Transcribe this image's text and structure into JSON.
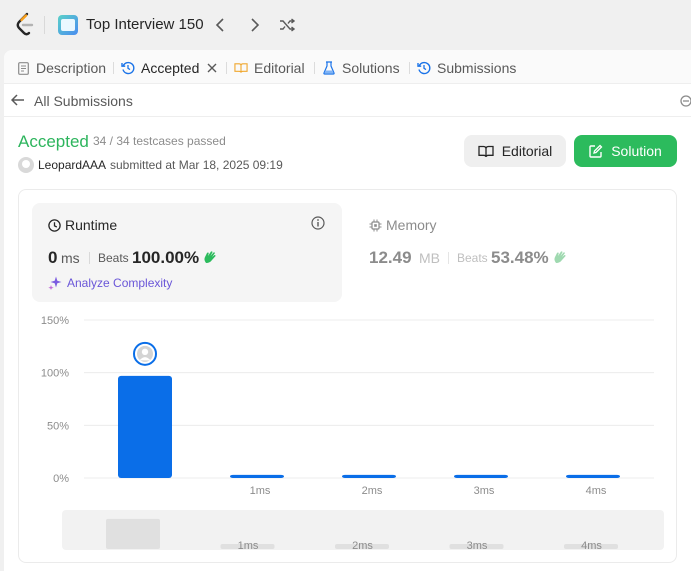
{
  "topbar": {
    "list_title": "Top Interview 150"
  },
  "tabs": [
    {
      "label": "Description",
      "icon": "description-icon"
    },
    {
      "label": "Accepted",
      "icon": "history-icon"
    },
    {
      "label": "Editorial",
      "icon": "book-icon"
    },
    {
      "label": "Solutions",
      "icon": "flask-icon"
    },
    {
      "label": "Submissions",
      "icon": "history-icon"
    }
  ],
  "subbar": {
    "back_label": "All Submissions"
  },
  "result": {
    "status": "Accepted",
    "testcases": "34 / 34 testcases passed",
    "username": "LeopardAAA",
    "submitted": "submitted at Mar 18, 2025 09:19"
  },
  "buttons": {
    "editorial": "Editorial",
    "solution": "Solution"
  },
  "runtime": {
    "title": "Runtime",
    "value": "0",
    "unit": "ms",
    "beats_label": "Beats",
    "beats_pct": "100.00%",
    "analyze": "Analyze Complexity"
  },
  "memory": {
    "title": "Memory",
    "value": "12.49",
    "unit": "MB",
    "beats_label": "Beats",
    "beats_pct": "53.48%"
  },
  "colors": {
    "accent_green": "#2cbb5d",
    "bar_blue": "#0a6ee8",
    "status_green": "#2db55d"
  },
  "chart_data": {
    "type": "bar",
    "ytick_labels": [
      "150%",
      "100%",
      "50%",
      "0%"
    ],
    "ylim": [
      0,
      150
    ],
    "categories": [
      "",
      "1ms",
      "2ms",
      "3ms",
      "4ms"
    ],
    "values": [
      97,
      3,
      3,
      3,
      3
    ],
    "highlight_index": 0,
    "overview_labels": [
      "1ms",
      "2ms",
      "3ms",
      "4ms"
    ]
  }
}
